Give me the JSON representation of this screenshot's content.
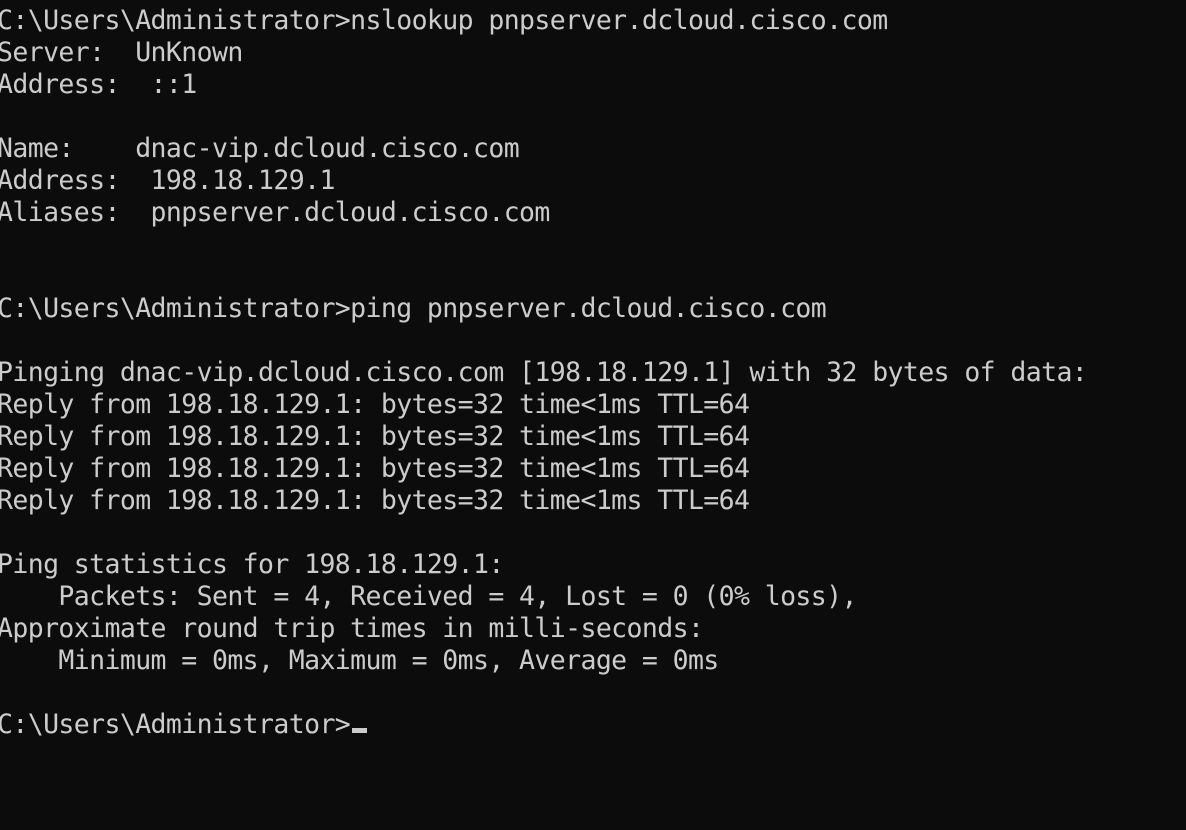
{
  "console": {
    "lines": [
      "C:\\Users\\Administrator>nslookup pnpserver.dcloud.cisco.com",
      "Server:  UnKnown",
      "Address:  ::1",
      "",
      "Name:    dnac-vip.dcloud.cisco.com",
      "Address:  198.18.129.1",
      "Aliases:  pnpserver.dcloud.cisco.com",
      "",
      "",
      "C:\\Users\\Administrator>ping pnpserver.dcloud.cisco.com",
      "",
      "Pinging dnac-vip.dcloud.cisco.com [198.18.129.1] with 32 bytes of data:",
      "Reply from 198.18.129.1: bytes=32 time<1ms TTL=64",
      "Reply from 198.18.129.1: bytes=32 time<1ms TTL=64",
      "Reply from 198.18.129.1: bytes=32 time<1ms TTL=64",
      "Reply from 198.18.129.1: bytes=32 time<1ms TTL=64",
      "",
      "Ping statistics for 198.18.129.1:",
      "    Packets: Sent = 4, Received = 4, Lost = 0 (0% loss),",
      "Approximate round trip times in milli-seconds:",
      "    Minimum = 0ms, Maximum = 0ms, Average = 0ms",
      "",
      "C:\\Users\\Administrator>"
    ],
    "colors": {
      "background": "#0c0c0c",
      "text": "#cccccc"
    }
  }
}
